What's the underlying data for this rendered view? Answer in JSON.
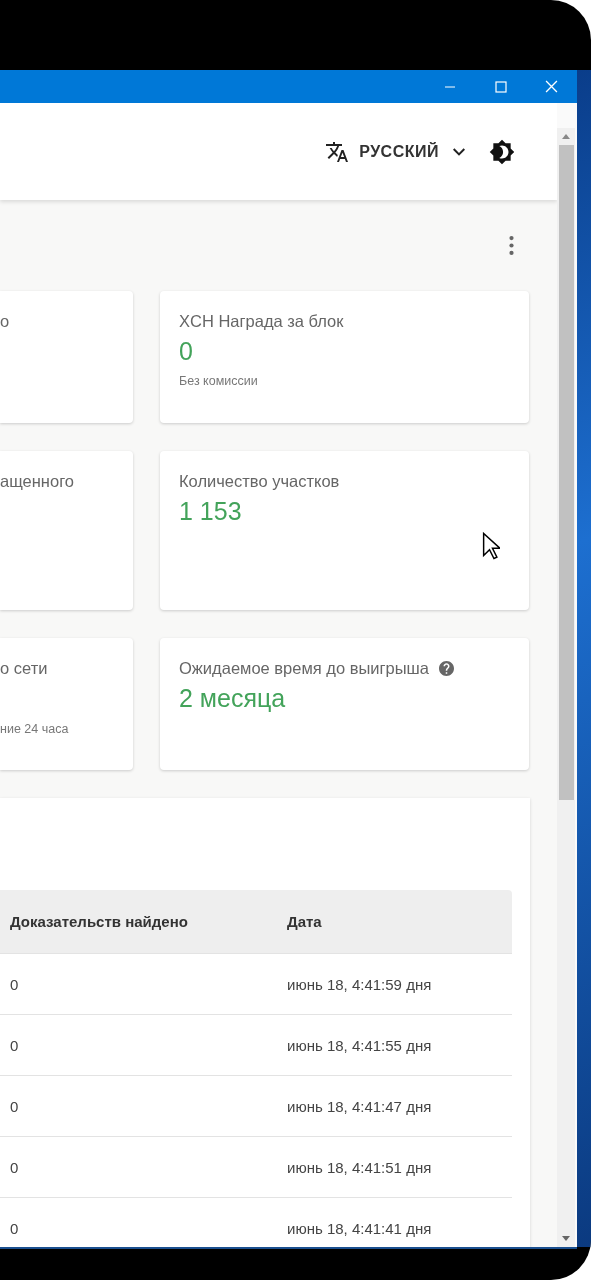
{
  "header": {
    "language": "РУССКИЙ"
  },
  "cards": [
    {
      "title": "о",
      "help": false
    },
    {
      "title": "XCH Награда за блок",
      "value": "0",
      "note": "Без комиссии",
      "help": false
    },
    {
      "title": "ащенного",
      "help": false
    },
    {
      "title": "Количество участков",
      "value": "1 153",
      "help": false
    },
    {
      "title": "о сети",
      "note": "ние 24 часа",
      "help": false
    },
    {
      "title": "Ожидаемое время до выигрыша",
      "value": "2 месяца",
      "help": true
    }
  ],
  "table": {
    "columns": [
      "Доказательств найдено",
      "Дата"
    ],
    "rows": [
      [
        "0",
        "июнь 18, 4:41:59 дня"
      ],
      [
        "0",
        "июнь 18, 4:41:55 дня"
      ],
      [
        "0",
        "июнь 18, 4:41:47 дня"
      ],
      [
        "0",
        "июнь 18, 4:41:51 дня"
      ],
      [
        "0",
        "июнь 18, 4:41:41 дня"
      ]
    ]
  }
}
